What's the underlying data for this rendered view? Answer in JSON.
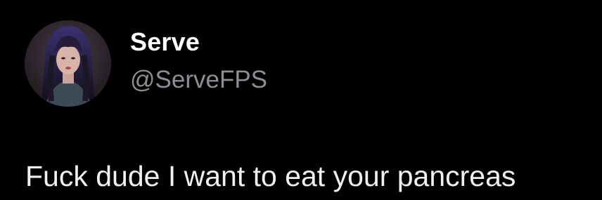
{
  "author": {
    "display_name": "Serve",
    "handle": "@ServeFPS",
    "avatar_icon": "profile-photo"
  },
  "tweet": {
    "text": "Fuck dude I want to eat your pancreas"
  },
  "colors": {
    "background": "#000000",
    "name": "#ffffff",
    "handle": "#8b8f95",
    "text": "#f0f0f0"
  }
}
